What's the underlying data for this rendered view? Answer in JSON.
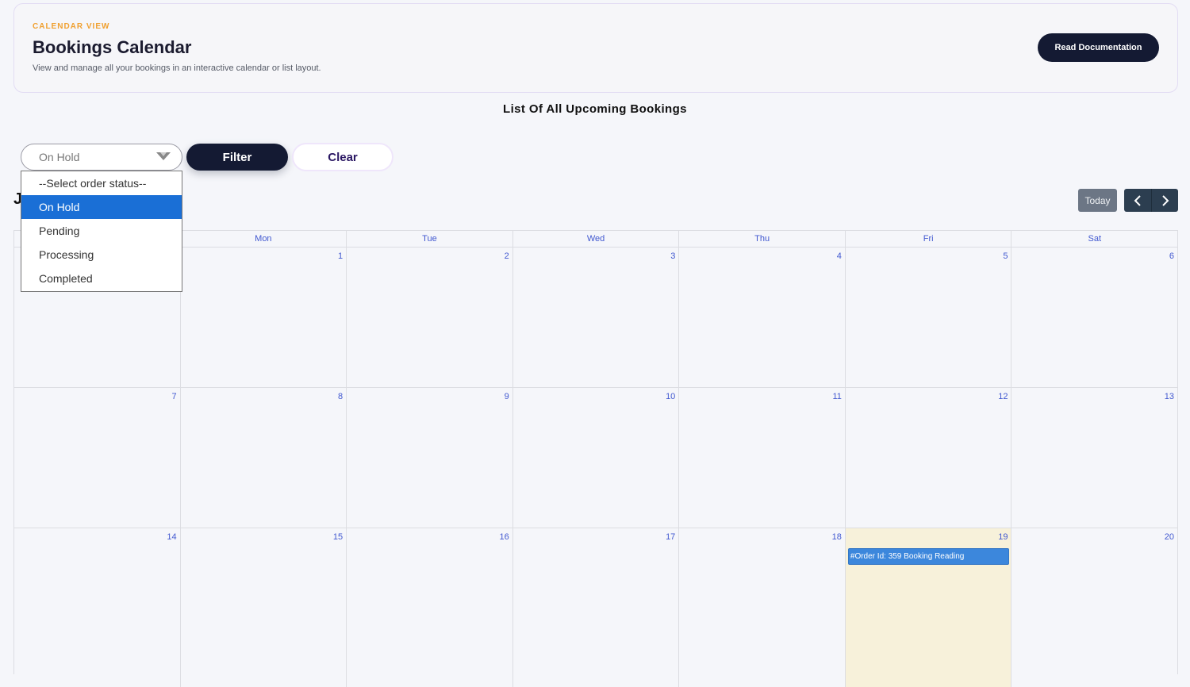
{
  "header": {
    "eyebrow": "CALENDAR VIEW",
    "title": "Bookings Calendar",
    "subtitle": "View and manage all your bookings in an interactive calendar or list layout.",
    "doc_button": "Read Documentation"
  },
  "section_title": "List Of All Upcoming Bookings",
  "filter": {
    "selected_value": "On Hold",
    "filter_label": "Filter",
    "clear_label": "Clear",
    "options": [
      "--Select order status--",
      "On Hold",
      "Pending",
      "Processing",
      "Completed"
    ]
  },
  "calendar": {
    "month_title_visible": "J",
    "today_label": "Today",
    "prev_icon": "chevron-left-icon",
    "next_icon": "chevron-right-icon",
    "day_headers": [
      "",
      "Mon",
      "Tue",
      "Wed",
      "Thu",
      "Fri",
      "Sat"
    ],
    "weeks": [
      [
        "",
        "1",
        "2",
        "3",
        "4",
        "5",
        "6"
      ],
      [
        "7",
        "8",
        "9",
        "10",
        "11",
        "12",
        "13"
      ],
      [
        "14",
        "15",
        "16",
        "17",
        "18",
        "19",
        "20"
      ]
    ],
    "today_day": "19",
    "event": "#Order Id: 359 Booking Reading"
  },
  "colors": {
    "accent_dark": "#141a33",
    "eyebrow": "#f0a030",
    "link_blue": "#4158d0",
    "event_blue": "#3c87dc",
    "today_bg": "#f7f1da",
    "selected_option": "#1a6fd6"
  }
}
